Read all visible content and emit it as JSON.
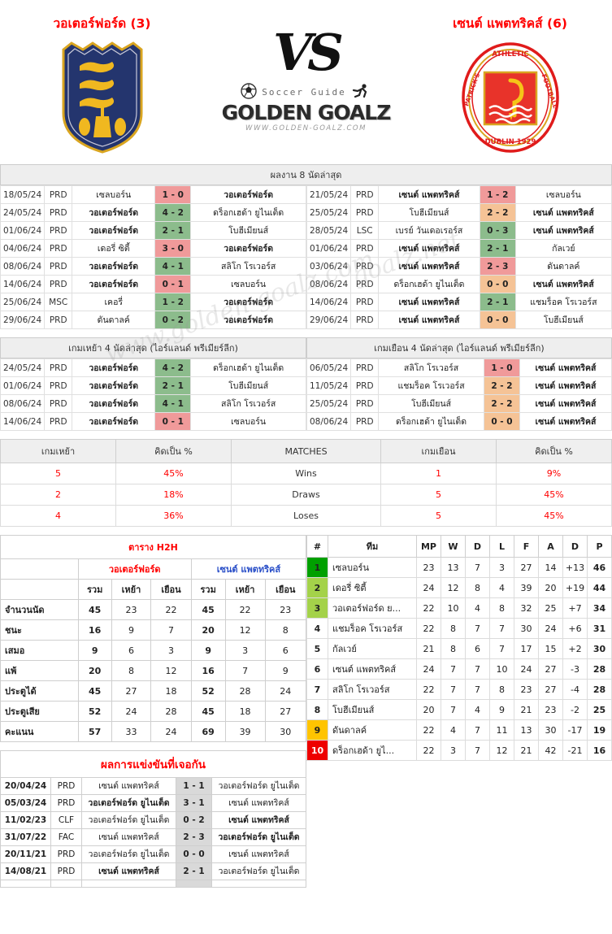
{
  "header": {
    "home_team": "วอเตอร์ฟอร์ด (3)",
    "away_team": "เซนต์ แพตทริคส์ (6)",
    "vs": "VS",
    "logo_small": "Soccer Guide",
    "logo_main": "GOLDEN GOALZ",
    "logo_url": "WWW.GOLDEN-GOALZ.COM"
  },
  "last8": {
    "title": "ผลงาน 8 นัดล่าสุด",
    "home_rows": [
      {
        "date": "18/05/24",
        "comp": "PRD",
        "home": "เซลบอร์น",
        "score": "1 - 0",
        "away": "วอเตอร์ฟอร์ด",
        "result": "lose",
        "bold": "away"
      },
      {
        "date": "24/05/24",
        "comp": "PRD",
        "home": "วอเตอร์ฟอร์ด",
        "score": "4 - 2",
        "away": "ดร็อกเฮด้า ยูไนเต็ด",
        "result": "win",
        "bold": "home"
      },
      {
        "date": "01/06/24",
        "comp": "PRD",
        "home": "วอเตอร์ฟอร์ด",
        "score": "2 - 1",
        "away": "โบฮีเมียนส์",
        "result": "win",
        "bold": "home"
      },
      {
        "date": "04/06/24",
        "comp": "PRD",
        "home": "เดอรี่ ซิตี้",
        "score": "3 - 0",
        "away": "วอเตอร์ฟอร์ด",
        "result": "lose",
        "bold": "away"
      },
      {
        "date": "08/06/24",
        "comp": "PRD",
        "home": "วอเตอร์ฟอร์ด",
        "score": "4 - 1",
        "away": "สลิโก โรเวอร์ส",
        "result": "win",
        "bold": "home"
      },
      {
        "date": "14/06/24",
        "comp": "PRD",
        "home": "วอเตอร์ฟอร์ด",
        "score": "0 - 1",
        "away": "เซลบอร์น",
        "result": "lose",
        "bold": "home"
      },
      {
        "date": "25/06/24",
        "comp": "MSC",
        "home": "เคอรี่",
        "score": "1 - 2",
        "away": "วอเตอร์ฟอร์ด",
        "result": "win",
        "bold": "away"
      },
      {
        "date": "29/06/24",
        "comp": "PRD",
        "home": "ดันดาลค์",
        "score": "0 - 2",
        "away": "วอเตอร์ฟอร์ด",
        "result": "win",
        "bold": "away"
      }
    ],
    "away_rows": [
      {
        "date": "21/05/24",
        "comp": "PRD",
        "home": "เซนต์ แพตทริคส์",
        "score": "1 - 2",
        "away": "เซลบอร์น",
        "result": "lose",
        "bold": "home"
      },
      {
        "date": "25/05/24",
        "comp": "PRD",
        "home": "โบฮีเมียนส์",
        "score": "2 - 2",
        "away": "เซนต์ แพตทริคส์",
        "result": "draw",
        "bold": "away"
      },
      {
        "date": "28/05/24",
        "comp": "LSC",
        "home": "เบรย์ วันเดอเรอร์ส",
        "score": "0 - 3",
        "away": "เซนต์ แพตทริคส์",
        "result": "win",
        "bold": "away"
      },
      {
        "date": "01/06/24",
        "comp": "PRD",
        "home": "เซนต์ แพตทริคส์",
        "score": "2 - 1",
        "away": "กัลเวย์",
        "result": "win",
        "bold": "home"
      },
      {
        "date": "03/06/24",
        "comp": "PRD",
        "home": "เซนต์ แพตทริคส์",
        "score": "2 - 3",
        "away": "ดันดาลค์",
        "result": "lose",
        "bold": "home"
      },
      {
        "date": "08/06/24",
        "comp": "PRD",
        "home": "ดร็อกเฮด้า ยูไนเต็ด",
        "score": "0 - 0",
        "away": "เซนต์ แพตทริคส์",
        "result": "draw",
        "bold": "away"
      },
      {
        "date": "14/06/24",
        "comp": "PRD",
        "home": "เซนต์ แพตทริคส์",
        "score": "2 - 1",
        "away": "แชมร็อค โรเวอร์ส",
        "result": "win",
        "bold": "home"
      },
      {
        "date": "29/06/24",
        "comp": "PRD",
        "home": "เซนต์ แพตทริคส์",
        "score": "0 - 0",
        "away": "โบฮีเมียนส์",
        "result": "draw",
        "bold": "home"
      }
    ]
  },
  "last4": {
    "home_title": "เกมเหย้า 4 นัดล่าสุด (ไอร์แลนด์ พรีเมียร์ลีก)",
    "away_title": "เกมเยือน 4 นัดล่าสุด (ไอร์แลนด์ พรีเมียร์ลีก)",
    "home_rows": [
      {
        "date": "24/05/24",
        "comp": "PRD",
        "home": "วอเตอร์ฟอร์ด",
        "score": "4 - 2",
        "away": "ดร็อกเฮด้า ยูไนเต็ด",
        "result": "win",
        "bold": "home"
      },
      {
        "date": "01/06/24",
        "comp": "PRD",
        "home": "วอเตอร์ฟอร์ด",
        "score": "2 - 1",
        "away": "โบฮีเมียนส์",
        "result": "win",
        "bold": "home"
      },
      {
        "date": "08/06/24",
        "comp": "PRD",
        "home": "วอเตอร์ฟอร์ด",
        "score": "4 - 1",
        "away": "สลิโก โรเวอร์ส",
        "result": "win",
        "bold": "home"
      },
      {
        "date": "14/06/24",
        "comp": "PRD",
        "home": "วอเตอร์ฟอร์ด",
        "score": "0 - 1",
        "away": "เซลบอร์น",
        "result": "lose",
        "bold": "home"
      }
    ],
    "away_rows": [
      {
        "date": "06/05/24",
        "comp": "PRD",
        "home": "สลิโก โรเวอร์ส",
        "score": "1 - 0",
        "away": "เซนต์ แพตทริคส์",
        "result": "lose",
        "bold": "away"
      },
      {
        "date": "11/05/24",
        "comp": "PRD",
        "home": "แชมร็อค โรเวอร์ส",
        "score": "2 - 2",
        "away": "เซนต์ แพตทริคส์",
        "result": "draw",
        "bold": "away"
      },
      {
        "date": "25/05/24",
        "comp": "PRD",
        "home": "โบฮีเมียนส์",
        "score": "2 - 2",
        "away": "เซนต์ แพตทริคส์",
        "result": "draw",
        "bold": "away"
      },
      {
        "date": "08/06/24",
        "comp": "PRD",
        "home": "ดร็อกเฮด้า ยูไนเต็ด",
        "score": "0 - 0",
        "away": "เซนต์ แพตทริคส์",
        "result": "draw",
        "bold": "away"
      }
    ]
  },
  "matches_stats": {
    "headers": [
      "เกมเหย้า",
      "คิดเป็น %",
      "MATCHES",
      "เกมเยือน",
      "คิดเป็น %"
    ],
    "rows": [
      {
        "home": "5",
        "home_pct": "45%",
        "label": "Wins",
        "away": "1",
        "away_pct": "9%"
      },
      {
        "home": "2",
        "home_pct": "18%",
        "label": "Draws",
        "away": "5",
        "away_pct": "45%"
      },
      {
        "home": "4",
        "home_pct": "36%",
        "label": "Loses",
        "away": "5",
        "away_pct": "45%"
      }
    ]
  },
  "h2h": {
    "title": "ตาราง H2H",
    "team_a": "วอเตอร์ฟอร์ด",
    "team_b": "เซนต์ แพตทริคส์",
    "sub_headers": [
      "รวม",
      "เหย้า",
      "เยือน",
      "รวม",
      "เหย้า",
      "เยือน"
    ],
    "rows": [
      {
        "label": "จำนวนนัด",
        "a_total": "45",
        "a_home": "23",
        "a_away": "22",
        "b_total": "45",
        "b_home": "22",
        "b_away": "23"
      },
      {
        "label": "ชนะ",
        "a_total": "16",
        "a_home": "9",
        "a_away": "7",
        "b_total": "20",
        "b_home": "12",
        "b_away": "8"
      },
      {
        "label": "เสมอ",
        "a_total": "9",
        "a_home": "6",
        "a_away": "3",
        "b_total": "9",
        "b_home": "3",
        "b_away": "6"
      },
      {
        "label": "แพ้",
        "a_total": "20",
        "a_home": "8",
        "a_away": "12",
        "b_total": "16",
        "b_home": "7",
        "b_away": "9"
      },
      {
        "label": "ประตูได้",
        "a_total": "45",
        "a_home": "27",
        "a_away": "18",
        "b_total": "52",
        "b_home": "28",
        "b_away": "24"
      },
      {
        "label": "ประตูเสีย",
        "a_total": "52",
        "a_home": "24",
        "a_away": "28",
        "b_total": "45",
        "b_home": "18",
        "b_away": "27"
      },
      {
        "label": "คะแนน",
        "a_total": "57",
        "a_home": "33",
        "a_away": "24",
        "b_total": "69",
        "b_home": "39",
        "b_away": "30"
      }
    ]
  },
  "standings": {
    "headers": [
      "#",
      "ทีม",
      "MP",
      "W",
      "D",
      "L",
      "F",
      "A",
      "D",
      "P"
    ],
    "rows": [
      {
        "pos": "1",
        "team": "เซลบอร์น",
        "mp": "23",
        "w": "13",
        "d": "7",
        "l": "3",
        "f": "27",
        "a": "14",
        "gd": "+13",
        "p": "46",
        "color": "#00a000"
      },
      {
        "pos": "2",
        "team": "เดอรี่ ซิตี้",
        "mp": "24",
        "w": "12",
        "d": "8",
        "l": "4",
        "f": "39",
        "a": "20",
        "gd": "+19",
        "p": "44",
        "color": "#a4d24a"
      },
      {
        "pos": "3",
        "team": "วอเตอร์ฟอร์ด ย...",
        "mp": "22",
        "w": "10",
        "d": "4",
        "l": "8",
        "f": "32",
        "a": "25",
        "gd": "+7",
        "p": "34",
        "color": "#a4d24a"
      },
      {
        "pos": "4",
        "team": "แชมร็อค โรเวอร์ส",
        "mp": "22",
        "w": "8",
        "d": "7",
        "l": "7",
        "f": "30",
        "a": "24",
        "gd": "+6",
        "p": "31",
        "color": ""
      },
      {
        "pos": "5",
        "team": "กัลเวย์",
        "mp": "21",
        "w": "8",
        "d": "6",
        "l": "7",
        "f": "17",
        "a": "15",
        "gd": "+2",
        "p": "30",
        "color": ""
      },
      {
        "pos": "6",
        "team": "เซนต์ แพตทริคส์",
        "mp": "24",
        "w": "7",
        "d": "7",
        "l": "10",
        "f": "24",
        "a": "27",
        "gd": "-3",
        "p": "28",
        "color": ""
      },
      {
        "pos": "7",
        "team": "สลิโก โรเวอร์ส",
        "mp": "22",
        "w": "7",
        "d": "7",
        "l": "8",
        "f": "23",
        "a": "27",
        "gd": "-4",
        "p": "28",
        "color": ""
      },
      {
        "pos": "8",
        "team": "โบฮีเมียนส์",
        "mp": "20",
        "w": "7",
        "d": "4",
        "l": "9",
        "f": "21",
        "a": "23",
        "gd": "-2",
        "p": "25",
        "color": ""
      },
      {
        "pos": "9",
        "team": "ดันดาลค์",
        "mp": "22",
        "w": "4",
        "d": "7",
        "l": "11",
        "f": "13",
        "a": "30",
        "gd": "-17",
        "p": "19",
        "color": "#ffc400"
      },
      {
        "pos": "10",
        "team": "ดร็อกเฮด้า ยูไ...",
        "mp": "22",
        "w": "3",
        "d": "7",
        "l": "12",
        "f": "21",
        "a": "42",
        "gd": "-21",
        "p": "16",
        "color": "#ee0000"
      }
    ]
  },
  "h2h_results": {
    "title": "ผลการแข่งขันที่เจอกัน",
    "rows": [
      {
        "date": "20/04/24",
        "comp": "PRD",
        "home": "เซนต์ แพตทริคส์",
        "score": "1 - 1",
        "away": "วอเตอร์ฟอร์ด ยูไนเต็ด",
        "bold": "none"
      },
      {
        "date": "05/03/24",
        "comp": "PRD",
        "home": "วอเตอร์ฟอร์ด ยูไนเต็ด",
        "score": "3 - 1",
        "away": "เซนต์ แพตทริคส์",
        "bold": "home"
      },
      {
        "date": "11/02/23",
        "comp": "CLF",
        "home": "วอเตอร์ฟอร์ด ยูไนเต็ด",
        "score": "0 - 2",
        "away": "เซนต์ แพตทริคส์",
        "bold": "away"
      },
      {
        "date": "31/07/22",
        "comp": "FAC",
        "home": "เซนต์ แพตทริคส์",
        "score": "2 - 3",
        "away": "วอเตอร์ฟอร์ด ยูไนเต็ด",
        "bold": "away"
      },
      {
        "date": "20/11/21",
        "comp": "PRD",
        "home": "วอเตอร์ฟอร์ด ยูไนเต็ด",
        "score": "0 - 0",
        "away": "เซนต์ แพตทริคส์",
        "bold": "none"
      },
      {
        "date": "14/08/21",
        "comp": "PRD",
        "home": "เซนต์ แพตทริคส์",
        "score": "2 - 1",
        "away": "วอเตอร์ฟอร์ด ยูไนเต็ด",
        "bold": "home"
      }
    ]
  }
}
